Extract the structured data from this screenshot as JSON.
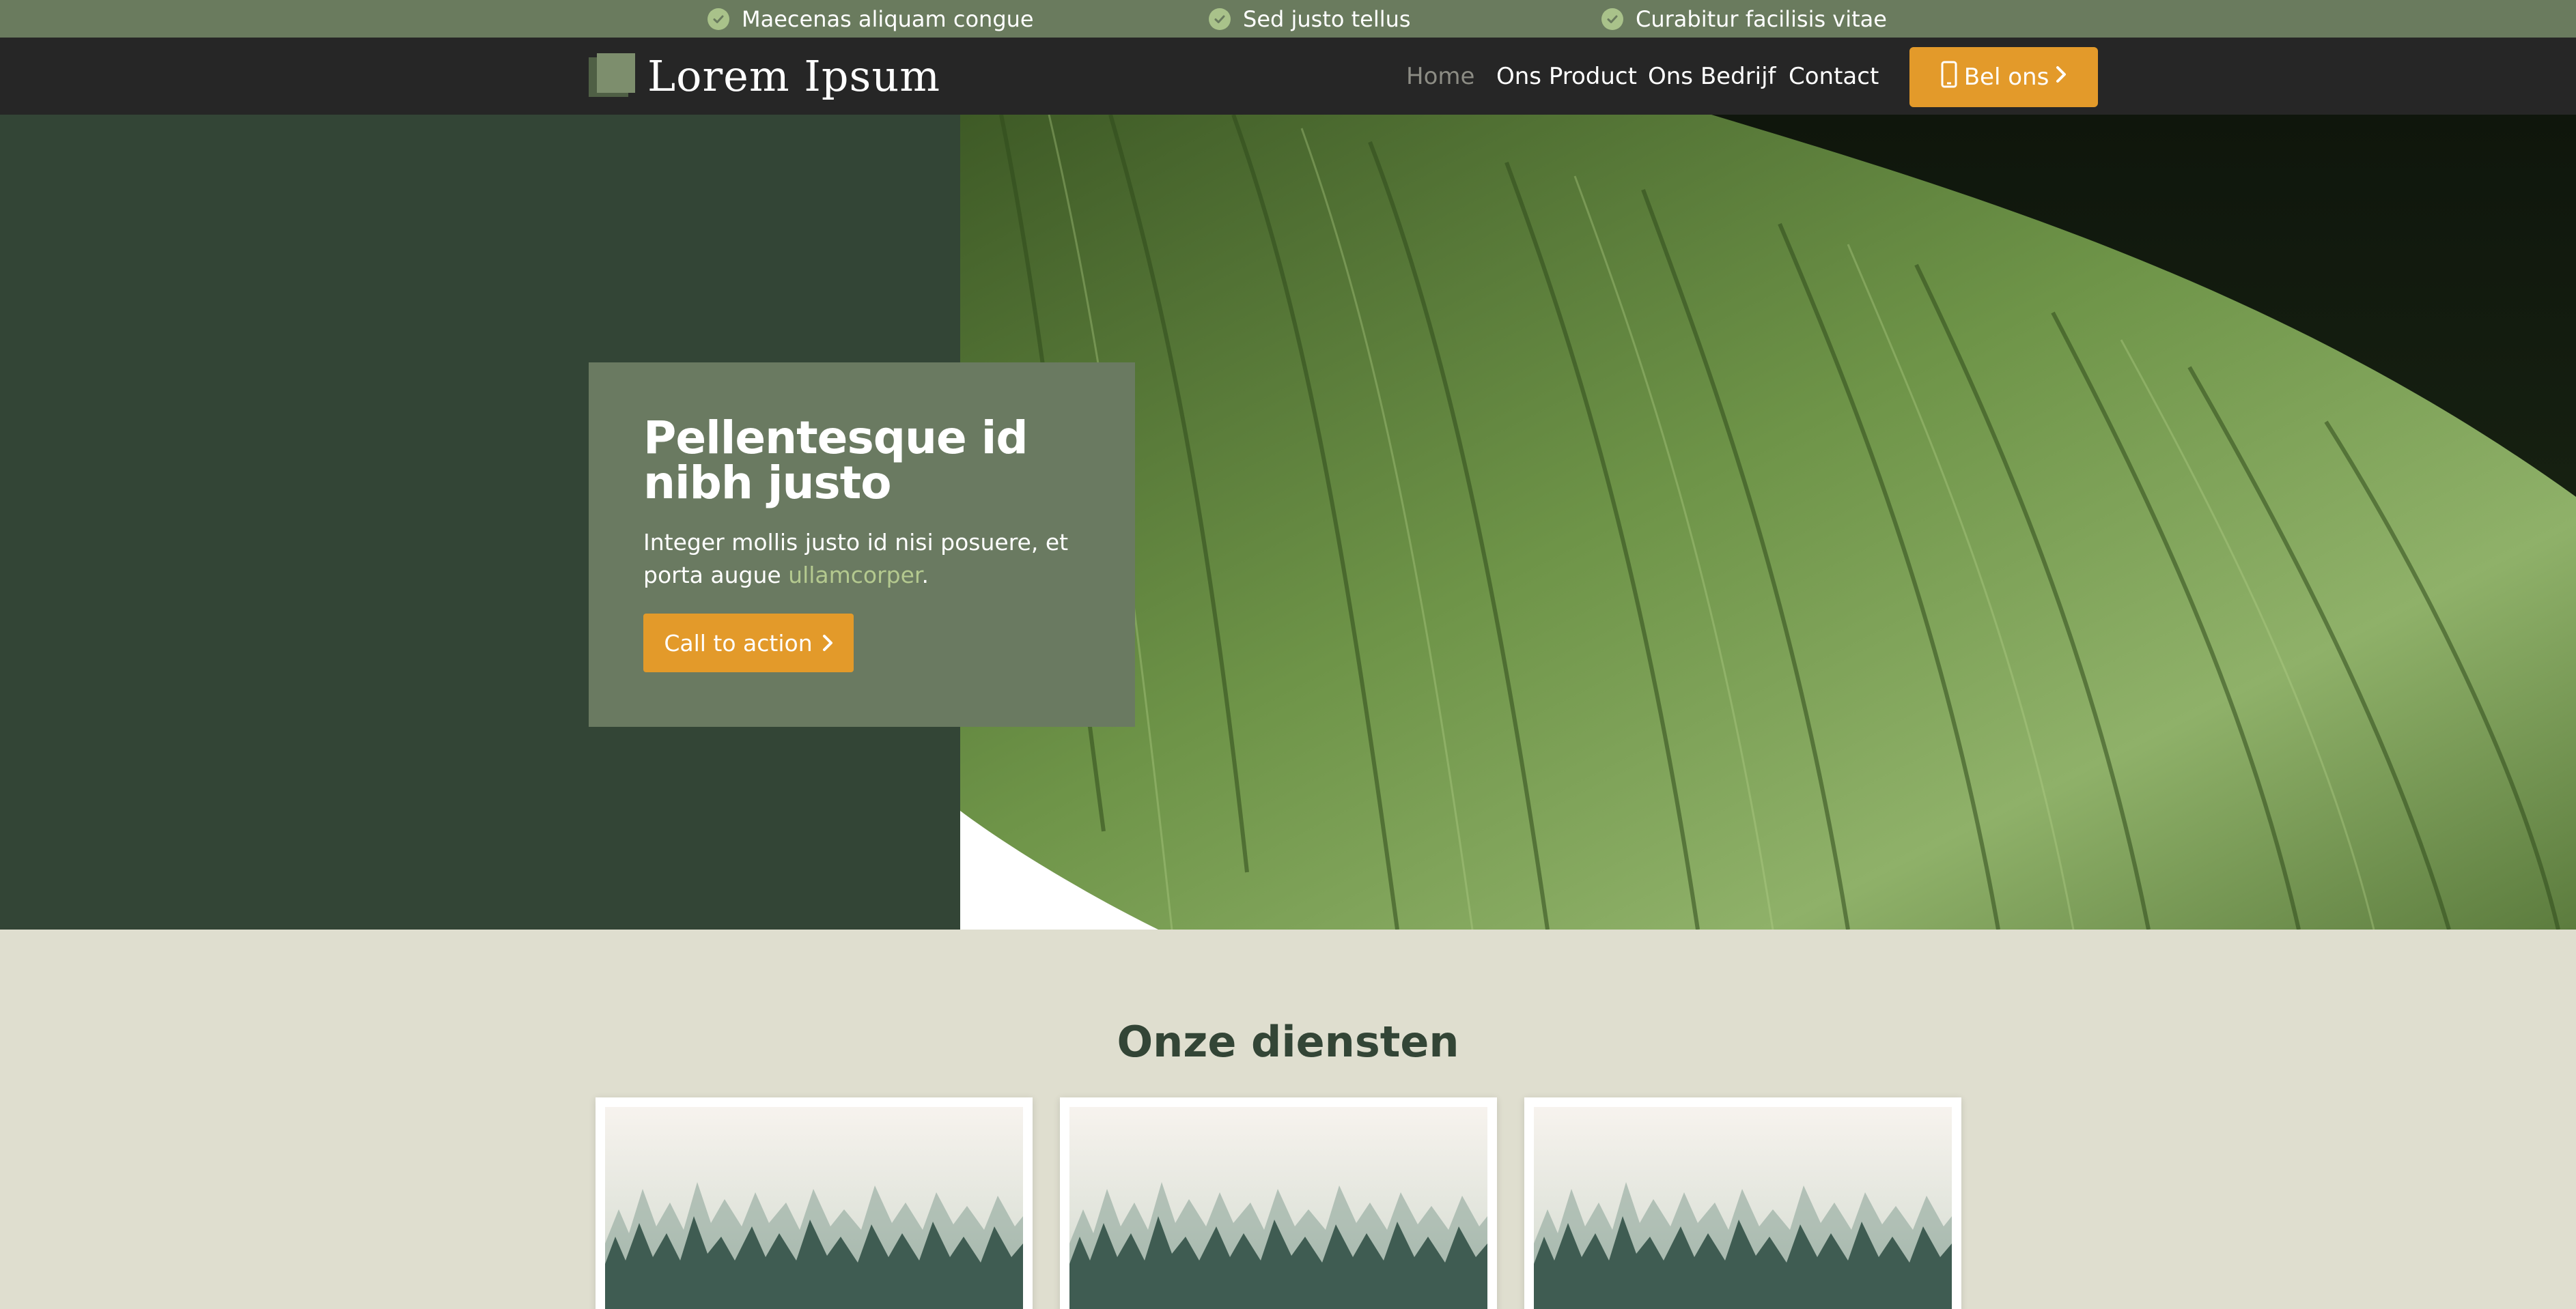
{
  "topbar": {
    "usps": [
      {
        "label": "Maecenas aliquam congue",
        "icon": "check-circle-icon"
      },
      {
        "label": "Sed justo tellus",
        "icon": "check-circle-icon"
      },
      {
        "label": "Curabitur facilisis vitae",
        "icon": "check-circle-icon"
      }
    ]
  },
  "header": {
    "logo_text": "Lorem Ipsum",
    "nav": [
      {
        "label": "Home",
        "active": true
      },
      {
        "label": "Ons Product",
        "active": false
      },
      {
        "label": "Ons Bedrijf",
        "active": false
      },
      {
        "label": "Contact",
        "active": false
      }
    ],
    "call_button": {
      "label": "Bel ons",
      "icon": "phone-icon",
      "trailing_icon": "chevron-right-icon"
    }
  },
  "hero": {
    "title": "Pellentesque id nibh justo",
    "text_before_link": "Integer mollis justo id nisi posuere, et porta augue ",
    "link_text": "ullamcorper",
    "text_after_link": ".",
    "button_label": "Call to action",
    "button_icon": "chevron-right-icon",
    "image": "leaf-image"
  },
  "services": {
    "title": "Onze diensten",
    "cards": [
      {
        "image": "misty-forest-image"
      },
      {
        "image": "misty-forest-image"
      },
      {
        "image": "misty-forest-image"
      }
    ]
  },
  "colors": {
    "topbar": "#6a7b5e",
    "header": "#262626",
    "hero_left": "#334536",
    "hero_card": "#6a7a61",
    "accent": "#e39a2a",
    "link": "#b4c98f",
    "page_bg": "#dfdecf",
    "title": "#334536"
  }
}
